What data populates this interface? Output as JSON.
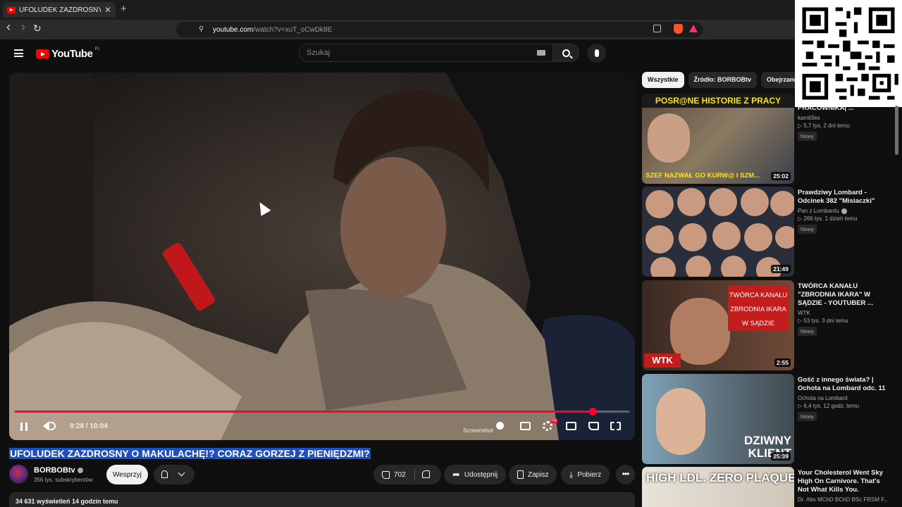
{
  "browser": {
    "tab_title": "UFOLUDEK ZAZDROSNY O M",
    "tab_close": "✕",
    "new_tab": "+",
    "back": "‹",
    "forward": "›",
    "reload": "↻",
    "url_host": "youtube.com",
    "url_path": "/watch?v=xuT_oCwDk8E"
  },
  "header": {
    "logo_text": "YouTube",
    "country": "PL",
    "search_placeholder": "Szukaj"
  },
  "player": {
    "progress": 0.94,
    "time": "9:28 / 10:04",
    "screenshot_label": "Screenshot",
    "hd_badge": "HD"
  },
  "video": {
    "title": "UFOLUDEK ZAZDROSNY O MAKULACHĘ!? CORAZ GORZEJ Z PIENIĘDZMI?",
    "channel": "BORBOBtv",
    "subscribers": "356 tys. subskrybentów",
    "support_label": "Wesprzyj",
    "likes": "702",
    "share_label": "Udostępnij",
    "save_label": "Zapisz",
    "download_label": "Pobierz",
    "more": "•••",
    "description_stats": "34 631 wyświetleń  14 godzin temu"
  },
  "sidebar": {
    "chips": [
      "Wszystkie",
      "Źródło: BORBOBtv",
      "Obejrzane"
    ],
    "cards": [
      {
        "thumb_text": "POSR@NE HISTORIE Z PRACY",
        "thumb_text2": "SZEF NAZWAŁ GO KURW@ I SZM...",
        "duration": "25:02",
        "title": "PUBLICZNE PONIŻANIE PRACOWNIKA| ...",
        "channel": "kamil3es",
        "stats": "▷ 5,7 tys.   2 dni temu",
        "badge": "Nowy"
      },
      {
        "duration": "21:49",
        "title": "Prawdziwy Lombard - Odcinek 382 \"Misiaczki\"",
        "channel": "Pan z Lombardu",
        "stats": "▷ 266 tys.   1 dzień temu",
        "badge": "Nowy"
      },
      {
        "thumb_text": "TWÓRCA KANAŁU ZBRODNIA IKARA W SĄDZIE",
        "thumb_logo": "WTK",
        "duration": "2:55",
        "title": "TWÓRCA KANAŁU \"ZBRODNIA IKARA\" W SĄDZIE - YOUTUBER ...",
        "channel": "WTK",
        "stats": "▷ 53 tys.   3 dni temu",
        "badge": "Nowy"
      },
      {
        "thumb_text": "DZIWNY KLIENT",
        "duration": "25:39",
        "title": "Gość z innego świata? | Ochota na Lombard odc. 11",
        "channel": "Ochota na Lombard",
        "stats": "▷ 6,4 tys.   12 godz. temu",
        "badge": "Nowy"
      },
      {
        "thumb_text": "HIGH LDL. ZERO PLAQUE.",
        "title": "Your Cholesterol Went Sky High On Carnivore. That's Not What Kills You.",
        "channel": "Dr. Abs MChD BChD BSc FRSM F..."
      }
    ]
  },
  "colors": {
    "accent_red": "#ff0033",
    "title_highlight": "#1e4fbf",
    "background": "#0f0f0f"
  }
}
